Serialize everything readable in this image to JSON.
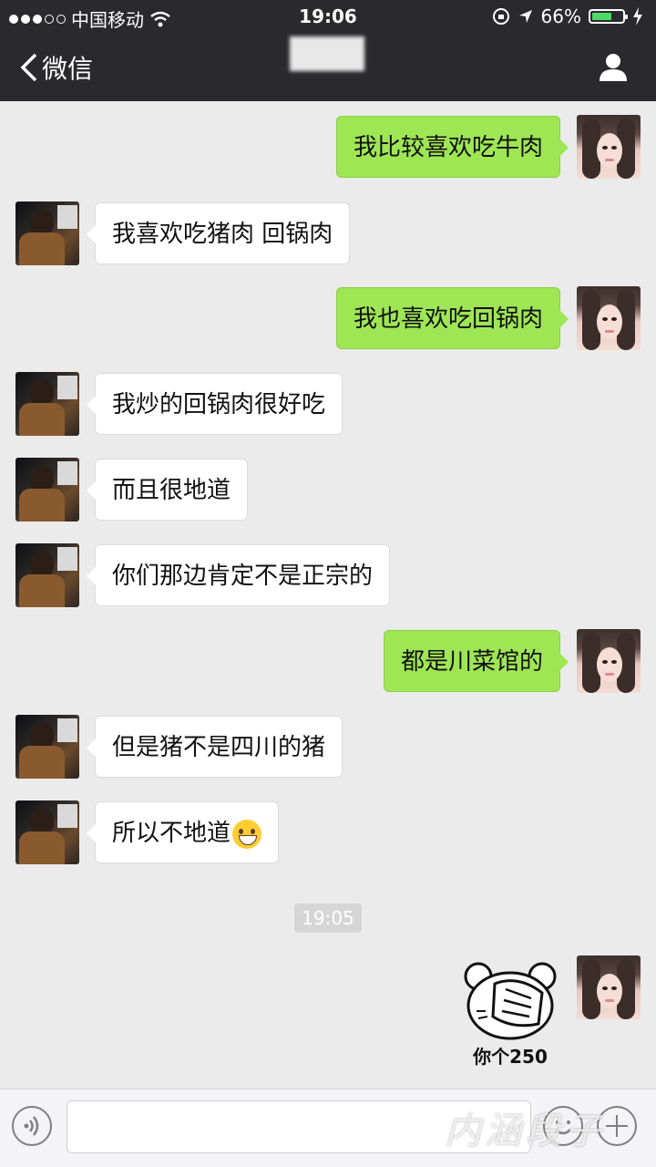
{
  "status_bar": {
    "carrier": "中国移动",
    "time": "19:06",
    "battery_percent": "66%",
    "battery_level": 0.66,
    "icons": [
      "signal-dots-icon",
      "wifi-icon",
      "rotation-lock-icon",
      "location-arrow-icon",
      "battery-icon",
      "charging-bolt-icon"
    ]
  },
  "nav": {
    "back_label": "微信",
    "title": "",
    "icons": [
      "back-chevron-icon",
      "profile-icon"
    ]
  },
  "messages": [
    {
      "side": "right",
      "text": "我比较喜欢吃牛肉"
    },
    {
      "side": "left",
      "text": "我喜欢吃猪肉 回锅肉"
    },
    {
      "side": "right",
      "text": "我也喜欢吃回锅肉"
    },
    {
      "side": "left",
      "text": "我炒的回锅肉很好吃"
    },
    {
      "side": "left",
      "text": "而且很地道"
    },
    {
      "side": "left",
      "text": "你们那边肯定不是正宗的"
    },
    {
      "side": "right",
      "text": "都是川菜馆的"
    },
    {
      "side": "left",
      "text": "但是猪不是四川的猪"
    },
    {
      "side": "left",
      "text": "所以不地道",
      "emoji": "grinning-face-icon"
    }
  ],
  "timestamp": "19:05",
  "sticker": {
    "caption": "你个250",
    "icon": "facepalm-bear-sticker"
  },
  "input_bar": {
    "icons": [
      "voice-icon",
      "emoji-icon",
      "plus-icon"
    ]
  },
  "watermark": "内涵段子",
  "colors": {
    "header_bg": "#2a2a2e",
    "chat_bg": "#ebebeb",
    "outgoing_bubble": "#9fe655",
    "incoming_bubble": "#ffffff",
    "battery_fill": "#4cd964"
  }
}
